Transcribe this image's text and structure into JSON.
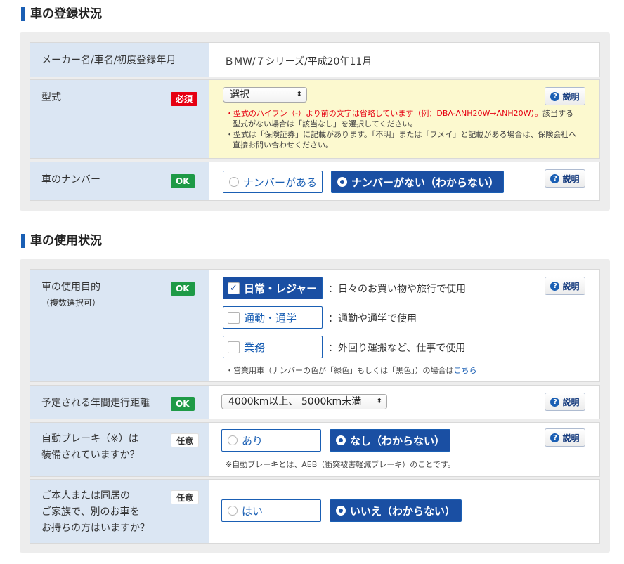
{
  "section1": {
    "title": "車の登録状況",
    "row_maker": {
      "label": "メーカー名/車名/初度登録年月",
      "value": "ＢMW/７シリーズ/平成20年11月"
    },
    "row_model": {
      "label": "型式",
      "badge": "必須",
      "select_value": "選択",
      "help_label": "説明",
      "note1_red": "・型式のハイフン（-）より前の文字は省略しています（例：DBA-ANH20W→ANH20W）。",
      "note1_rest": "該当する型式がない場合は「該当なし」を選択してください。",
      "note2": "・型式は「保険証券」に記載があります。「不明」または「フメイ」と記載がある場合は、保険会社へ直接お問い合わせください。"
    },
    "row_plate": {
      "label": "車のナンバー",
      "badge": "OK",
      "options": [
        "ナンバーがある",
        "ナンバーがない（わからない）"
      ],
      "selected_index": 1,
      "help_label": "説明"
    }
  },
  "section2": {
    "title": "車の使用状況",
    "row_purpose": {
      "label": "車の使用目的",
      "sublabel": "（複数選択可）",
      "badge": "OK",
      "help_label": "説明",
      "options": [
        {
          "label": "日常・レジャー",
          "desc": "：日々のお買い物や旅行で使用",
          "checked": true
        },
        {
          "label": "通勤・通学",
          "desc": "：通勤や通学で使用",
          "checked": false
        },
        {
          "label": "業務",
          "desc": "：外回り運搬など、仕事で使用",
          "checked": false
        }
      ],
      "note": "・営業用車（ナンバーの色が「緑色」もしくは「黒色」）の場合は",
      "note_link": "こちら"
    },
    "row_mileage": {
      "label": "予定される年間走行距離",
      "badge": "OK",
      "select_value": "4000km以上、 5000km未満",
      "help_label": "説明"
    },
    "row_brake": {
      "label_line1": "自動ブレーキ（※）は",
      "label_line2": "装備されていますか？",
      "badge": "任意",
      "options": [
        "あり",
        "なし（わからない）"
      ],
      "selected_index": 1,
      "help_label": "説明",
      "note": "※自動ブレーキとは、AEB（衝突被害軽減ブレーキ）のことです。"
    },
    "row_other_car": {
      "label_line1": "ご本人または同居の",
      "label_line2": "ご家族で、別のお車を",
      "label_line3": "お持ちの方はいますか？",
      "badge": "任意",
      "options": [
        "はい",
        "いいえ（わからない）"
      ],
      "selected_index": 1
    }
  },
  "colors": {
    "accent": "#1a5fb4",
    "selected_bg": "#1a4fa3",
    "label_bg": "#dbe6f3",
    "required": "#e60012",
    "ok": "#1e9a46",
    "highlight": "#fcf9cf"
  },
  "icons": {
    "help": "question-circle-icon",
    "radio": "radio-icon",
    "check": "checkmark-icon",
    "select_arrow": "updown-arrow-icon"
  }
}
